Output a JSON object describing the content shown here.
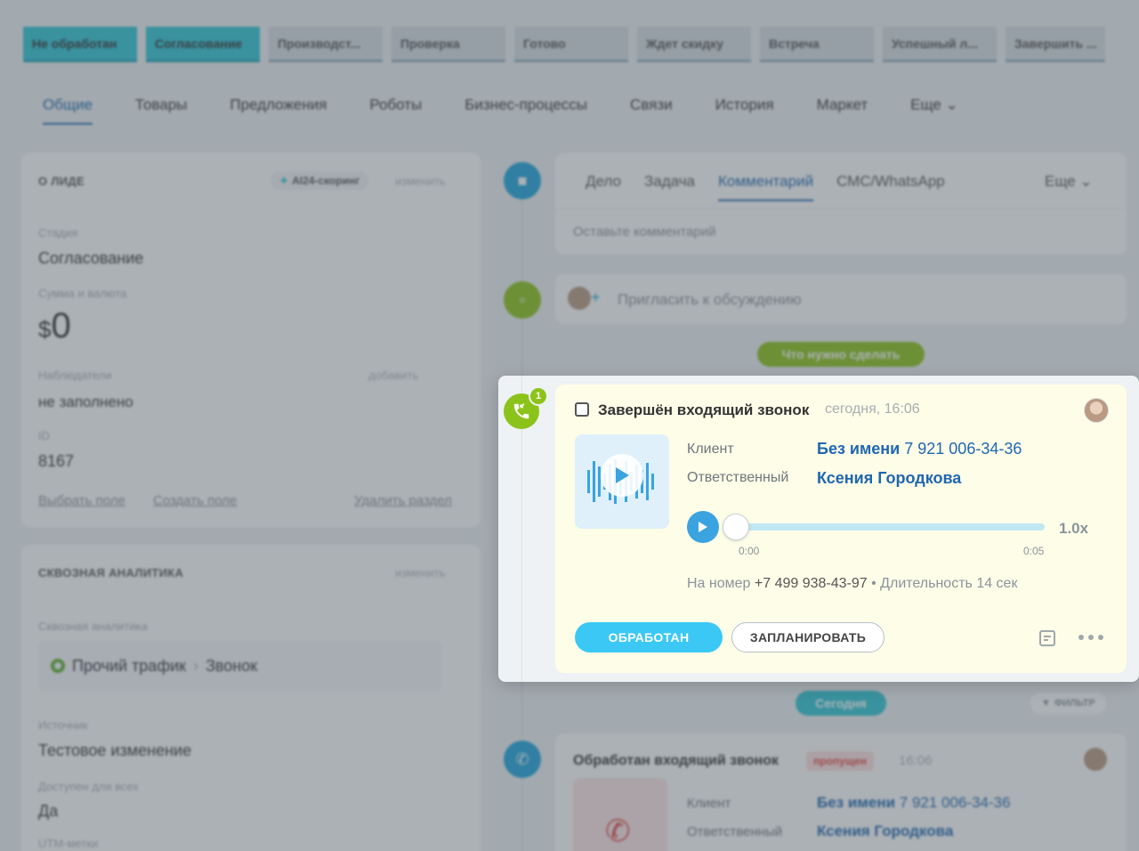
{
  "stages": [
    {
      "label": "Не обработан",
      "active": true
    },
    {
      "label": "Согласование",
      "active": true
    },
    {
      "label": "Производст...",
      "active": false
    },
    {
      "label": "Проверка",
      "active": false
    },
    {
      "label": "Готово",
      "active": false
    },
    {
      "label": "Ждет скидку",
      "active": false
    },
    {
      "label": "Встреча",
      "active": false
    },
    {
      "label": "Успешный л...",
      "active": false
    },
    {
      "label": "Завершить ...",
      "active": false
    }
  ],
  "tabs": [
    "Общие",
    "Товары",
    "Предложения",
    "Роботы",
    "Бизнес-процессы",
    "Связи",
    "История",
    "Маркет",
    "Еще"
  ],
  "lead": {
    "title": "О ЛИДЕ",
    "scoring": "AI24-скоринг",
    "edit": "изменить",
    "stage_label": "Стадия",
    "stage_value": "Согласование",
    "amount_label": "Сумма и валюта",
    "currency": "$",
    "amount": "0",
    "observers_label": "Наблюдатели",
    "observers_add": "добавить",
    "observers_value": "не заполнено",
    "id_label": "ID",
    "id_value": "8167",
    "choose_field": "Выбрать поле",
    "create_field": "Создать поле",
    "delete_section": "Удалить раздел"
  },
  "analytics": {
    "title": "СКВОЗНАЯ АНАЛИТИКА",
    "edit": "изменить",
    "label": "Сквозная аналитика",
    "source_chain": "Прочий трафик",
    "source_target": "Звонок",
    "source_label": "Источник",
    "source_value": "Тестовое изменение",
    "available_label": "Доступен для всех",
    "available_value": "Да",
    "utm_label": "UTM-метки"
  },
  "composer": {
    "tabs": [
      "Дело",
      "Задача",
      "Комментарий",
      "СМС/WhatsApp"
    ],
    "more": "Еще",
    "placeholder": "Оставьте комментарий"
  },
  "invite": "Пригласить к обсуждению",
  "todo_pill": "Что нужно сделать",
  "today_pill": "Сегодня",
  "filter": "ФИЛЬТР",
  "call": {
    "badge": "1",
    "title": "Завершён входящий звонок",
    "time": "сегодня, 16:06",
    "client_label": "Клиент",
    "client_name": "Без имени",
    "client_phone": "7 921 006-34-36",
    "responsible_label": "Ответственный",
    "responsible_name": "Ксения Городкова",
    "speed": "1.0x",
    "time_start": "0:00",
    "time_end": "0:05",
    "progress": 0,
    "info_prefix": "На номер",
    "info_number": "+7 499 938-43-97",
    "info_duration": "• Длительность 14 сек",
    "btn_done": "ОБРАБОТАН",
    "btn_plan": "ЗАПЛАНИРОВАТЬ"
  },
  "processed_call": {
    "title": "Обработан входящий звонок",
    "status": "пропущен",
    "time": "16:06",
    "client_label": "Клиент",
    "client_name": "Без имени",
    "client_phone": "7 921 006-34-36",
    "responsible_label": "Ответственный",
    "responsible_name": "Ксения Городкова"
  },
  "colors": {
    "accent": "#2067b0",
    "stage_active": "#2fc6d6",
    "call_green": "#8cc31a",
    "done_button": "#3bc8f5",
    "timeline_blue": "#1fa5dd"
  }
}
